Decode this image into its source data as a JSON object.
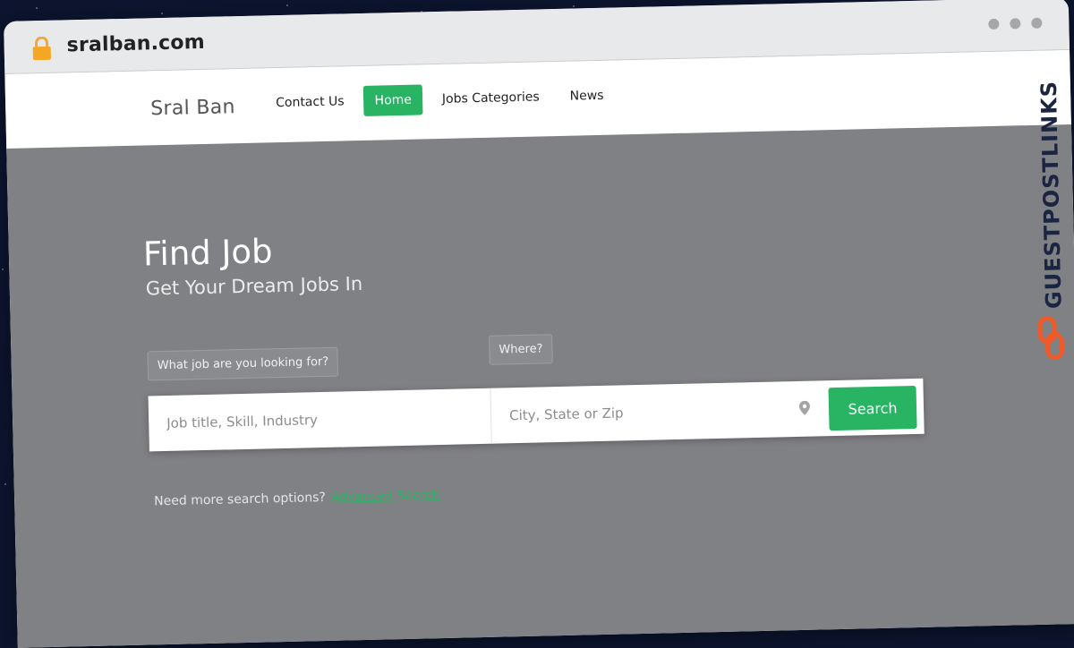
{
  "browser": {
    "url": "sralban.com"
  },
  "site": {
    "brand": "Sral Ban",
    "nav": [
      {
        "label": "Contact Us",
        "active": false
      },
      {
        "label": "Home",
        "active": true
      },
      {
        "label": "Jobs Categories",
        "active": false
      },
      {
        "label": "News",
        "active": false
      }
    ]
  },
  "hero": {
    "title": "Find Job",
    "subtitle": "Get Your Dream Jobs In",
    "what_label": "What job are you looking for?",
    "where_label": "Where?",
    "job_placeholder": "Job title, Skill, Industry",
    "where_placeholder": "City, State or Zip",
    "search_label": "Search",
    "more_text": "Need more search options?",
    "advanced_link": "Advanced Search"
  },
  "watermark": {
    "text": "GUESTPOSTLINKS"
  },
  "colors": {
    "accent": "#28b463",
    "hero_bg": "#808185",
    "badge_orange": "#f05a28"
  },
  "icons": {
    "lock": "lock-icon",
    "pin": "location-pin-icon",
    "link": "chain-link-icon"
  }
}
